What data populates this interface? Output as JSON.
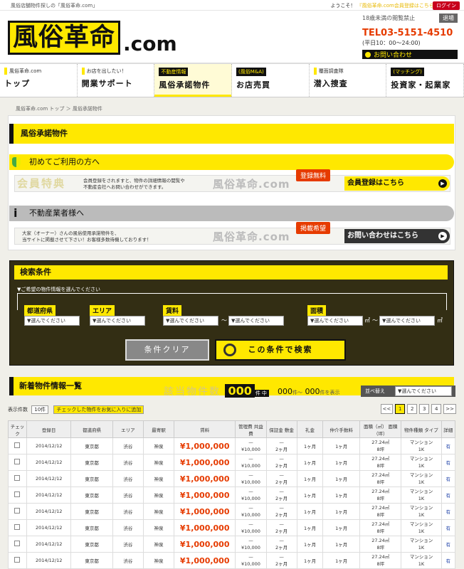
{
  "topbar": {
    "tagline": "風俗店舗物件探しの「風俗革命.com」",
    "welcome": "ようこそ！",
    "member_link": "『風俗革命.com会員登録はこちら',",
    "login": "ログイン"
  },
  "header": {
    "logo_text": "風俗革命",
    "logo_com": ".com",
    "age_notice": "18歳未満の閲覧禁止",
    "exit": "退場",
    "tel": "TEL03-5151-4510",
    "hours": "(平日10：00〜24:00)",
    "contact": "お問い合わせ"
  },
  "nav": [
    {
      "small": "風俗革命.com",
      "big": "トップ"
    },
    {
      "small": "お店を出したい！",
      "big": "開業サポート"
    },
    {
      "small": "不動産情報",
      "big": "風俗承諾物件"
    },
    {
      "small": "(風俗M&A)",
      "big": "お店売買"
    },
    {
      "small": "覆面調査隊",
      "big": "潜入捜査"
    },
    {
      "small": "(マッチング)",
      "big": "投資家・起業家"
    }
  ],
  "breadcrumb": "風俗革命.com トップ ＞ 風俗承諾物件",
  "page_title": "風俗承諾物件",
  "first_time": {
    "heading": "初めてご利用の方へ",
    "label": "会員特典",
    "text1": "会員登録をされますと、物件の詳細情報の閲覧や",
    "text2": "不動産会社へお問い合わせができます。",
    "logo": "風俗革命.com",
    "tag": "登録無料",
    "button": "会員登録はこちら"
  },
  "agents": {
    "heading": "不動産業者様へ",
    "text1": "大家（オーナー）さんの風俗使用承諾物件を、",
    "text2": "当サイトに掲載させて下さい！お客様多数待機しております！",
    "logo": "風俗革命.com",
    "tag": "掲載希望",
    "button": "お問い合わせはこちら"
  },
  "search": {
    "heading": "検索条件",
    "note": "▼ご希望の物件情報を選んでください",
    "labels": {
      "pref": "都道府県",
      "area": "エリア",
      "rent": "賃料",
      "size": "面積"
    },
    "select_placeholder": "▼選んでください",
    "tilde": "〜",
    "unit": "㎡",
    "clear": "条件クリア",
    "submit": "この条件で検索"
  },
  "list": {
    "heading": "新着物件情報一覧",
    "hits_label": "該当物件数",
    "hits": "000",
    "hits_unit": "件中",
    "range_from": "000",
    "range_to": "000",
    "range_sep": "件〜",
    "range_suffix": "件を表示",
    "sort_label": "並べ替え",
    "sort_value": "▼選んでください",
    "display_label": "表示件数",
    "display_value": "10件",
    "fav_button": "チェックした物件をお気に入りに追加",
    "pages": [
      "<<",
      "1",
      "2",
      "3",
      "4",
      ">>"
    ],
    "current_page": "1"
  },
  "table": {
    "headers": [
      "チェック",
      "登録日",
      "都道府県",
      "エリア",
      "最寄駅",
      "賃料",
      "管理費 共益費",
      "保証金 敷金",
      "礼金",
      "仲介手数料",
      "面積（㎡） 面積（坪）",
      "物件種類 タイプ",
      "詳細"
    ],
    "rows": [
      {
        "date": "2014/12/12",
        "pref": "東京都",
        "area": "渋谷",
        "station": "神泉",
        "rent": "¥1,000,000",
        "mgmt1": "—",
        "mgmt2": "¥10,000",
        "dep1": "—",
        "dep2": "2ヶ月",
        "key": "1ヶ月",
        "fee": "1ヶ月",
        "size1": "27.24㎡",
        "size2": "8坪",
        "type1": "マンション",
        "type2": "1K",
        "detail": "有"
      },
      {
        "date": "2014/12/12",
        "pref": "東京都",
        "area": "渋谷",
        "station": "神泉",
        "rent": "¥1,000,000",
        "mgmt1": "—",
        "mgmt2": "¥10,000",
        "dep1": "—",
        "dep2": "2ヶ月",
        "key": "1ヶ月",
        "fee": "1ヶ月",
        "size1": "27.24㎡",
        "size2": "8坪",
        "type1": "マンション",
        "type2": "1K",
        "detail": "有"
      },
      {
        "date": "2014/12/12",
        "pref": "東京都",
        "area": "渋谷",
        "station": "神泉",
        "rent": "¥1,000,000",
        "mgmt1": "—",
        "mgmt2": "¥10,000",
        "dep1": "—",
        "dep2": "2ヶ月",
        "key": "1ヶ月",
        "fee": "1ヶ月",
        "size1": "27.24㎡",
        "size2": "8坪",
        "type1": "マンション",
        "type2": "1K",
        "detail": "有"
      },
      {
        "date": "2014/12/12",
        "pref": "東京都",
        "area": "渋谷",
        "station": "神泉",
        "rent": "¥1,000,000",
        "mgmt1": "—",
        "mgmt2": "¥10,000",
        "dep1": "—",
        "dep2": "2ヶ月",
        "key": "1ヶ月",
        "fee": "1ヶ月",
        "size1": "27.24㎡",
        "size2": "8坪",
        "type1": "マンション",
        "type2": "1K",
        "detail": "有"
      },
      {
        "date": "2014/12/12",
        "pref": "東京都",
        "area": "渋谷",
        "station": "神泉",
        "rent": "¥1,000,000",
        "mgmt1": "—",
        "mgmt2": "¥10,000",
        "dep1": "—",
        "dep2": "2ヶ月",
        "key": "1ヶ月",
        "fee": "1ヶ月",
        "size1": "27.24㎡",
        "size2": "8坪",
        "type1": "マンション",
        "type2": "1K",
        "detail": "有"
      },
      {
        "date": "2014/12/12",
        "pref": "東京都",
        "area": "渋谷",
        "station": "神泉",
        "rent": "¥1,000,000",
        "mgmt1": "—",
        "mgmt2": "¥10,000",
        "dep1": "—",
        "dep2": "2ヶ月",
        "key": "1ヶ月",
        "fee": "1ヶ月",
        "size1": "27.24㎡",
        "size2": "8坪",
        "type1": "マンション",
        "type2": "1K",
        "detail": "有"
      },
      {
        "date": "2014/12/12",
        "pref": "東京都",
        "area": "渋谷",
        "station": "神泉",
        "rent": "¥1,000,000",
        "mgmt1": "—",
        "mgmt2": "¥10,000",
        "dep1": "—",
        "dep2": "2ヶ月",
        "key": "1ヶ月",
        "fee": "1ヶ月",
        "size1": "27.24㎡",
        "size2": "8坪",
        "type1": "マンション",
        "type2": "1K",
        "detail": "有"
      },
      {
        "date": "2014/12/12",
        "pref": "東京都",
        "area": "渋谷",
        "station": "神泉",
        "rent": "¥1,000,000",
        "mgmt1": "—",
        "mgmt2": "¥10,000",
        "dep1": "—",
        "dep2": "2ヶ月",
        "key": "1ヶ月",
        "fee": "1ヶ月",
        "size1": "27.24㎡",
        "size2": "8坪",
        "type1": "マンション",
        "type2": "1K",
        "detail": "有"
      },
      {
        "date": "2014/12/12",
        "pref": "東京都",
        "area": "渋谷",
        "station": "神泉",
        "rent": "¥1,000,000",
        "mgmt1": "—",
        "mgmt2": "¥10,000",
        "dep1": "—",
        "dep2": "2ヶ月",
        "key": "1ヶ月",
        "fee": "1ヶ月",
        "size1": "27.24㎡",
        "size2": "8坪",
        "type1": "マンション",
        "type2": "1K",
        "detail": "有"
      }
    ]
  }
}
